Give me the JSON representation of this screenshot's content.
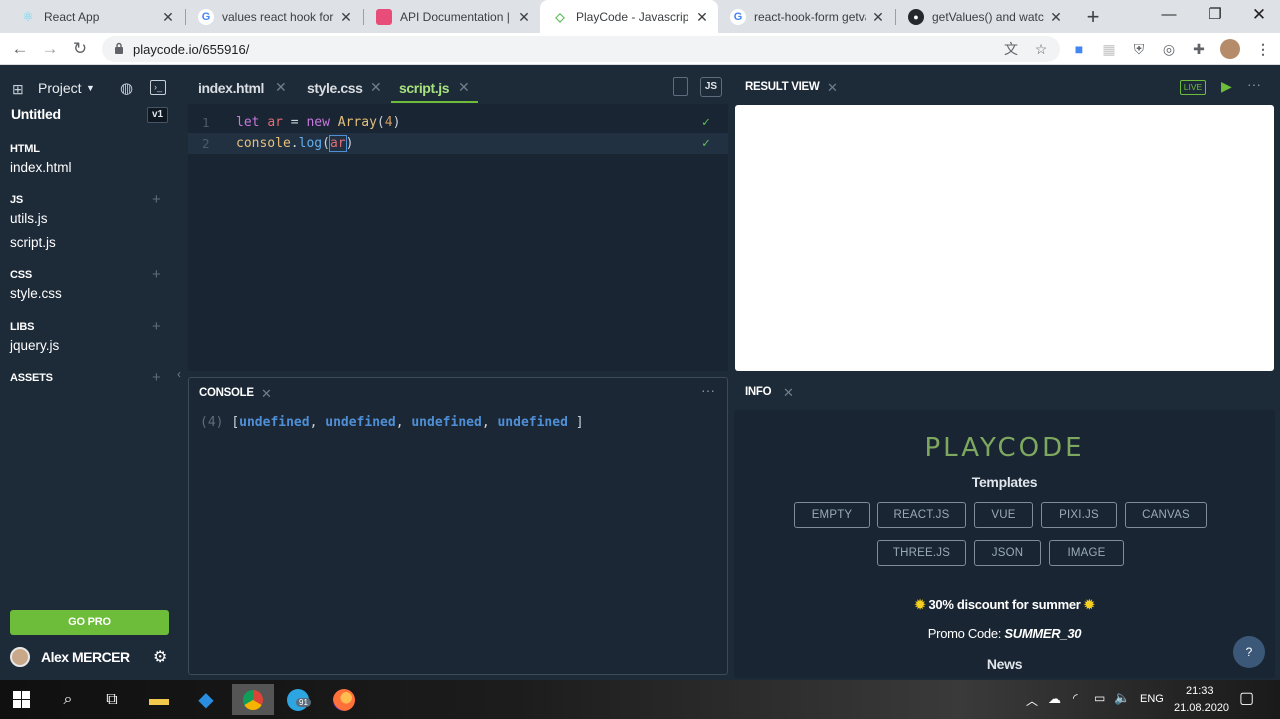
{
  "browser": {
    "tabs": [
      {
        "title": "React App",
        "icon": "react-icon"
      },
      {
        "title": "values react hook form",
        "icon": "google-icon"
      },
      {
        "title": "API Documentation | Re",
        "icon": "doc-icon"
      },
      {
        "title": "PlayCode - Javascript P",
        "icon": "playcode-icon",
        "active": true
      },
      {
        "title": "react-hook-form getval",
        "icon": "google-icon"
      },
      {
        "title": "getValues() and watch()",
        "icon": "github-icon"
      }
    ],
    "url": "playcode.io/655916/"
  },
  "sidebar": {
    "project_label": "Project",
    "project_name": "Untitled",
    "version_badge": "v1",
    "sections": [
      {
        "title": "HTML",
        "files": [
          "index.html"
        ],
        "addable": false
      },
      {
        "title": "JS",
        "files": [
          "utils.js",
          "script.js"
        ],
        "addable": true
      },
      {
        "title": "CSS",
        "files": [
          "style.css"
        ],
        "addable": true
      },
      {
        "title": "LIBS",
        "files": [
          "jquery.js"
        ],
        "addable": true
      },
      {
        "title": "ASSETS",
        "files": [],
        "addable": true
      }
    ],
    "go_pro_label": "GO PRO",
    "user_name": "Alex MERCER"
  },
  "editor": {
    "tabs": [
      "index.html",
      "style.css",
      "script.js"
    ],
    "active_tab": "script.js",
    "lang_badge": "JS",
    "lines": [
      {
        "num": "1",
        "tokens": [
          [
            "let ",
            "#c678dd"
          ],
          [
            "ar",
            "#e06c75"
          ],
          [
            " = ",
            "#c9d1d9"
          ],
          [
            "new ",
            "#c678dd"
          ],
          [
            "Array",
            "#e5c07b"
          ],
          [
            "(",
            "#c9d1d9"
          ],
          [
            "4",
            "#d19a66"
          ],
          [
            ")",
            "#c9d1d9"
          ]
        ]
      },
      {
        "num": "2",
        "tokens": [
          [
            "console",
            "#e5c07b"
          ],
          [
            ".",
            "#c9d1d9"
          ],
          [
            "log",
            "#61afef"
          ],
          [
            "(",
            "#c9d1d9"
          ],
          [
            "ar",
            "#e06c75"
          ],
          [
            ")",
            "#c9d1d9"
          ]
        ]
      }
    ]
  },
  "result": {
    "title": "RESULT VIEW",
    "live_badge": "LIVE"
  },
  "console": {
    "title": "CONSOLE",
    "output_count": "(4)",
    "output_items": [
      "undefined",
      "undefined",
      "undefined",
      "undefined"
    ]
  },
  "info": {
    "title": "INFO",
    "brand": "PLAYCODE",
    "templates_title": "Templates",
    "templates_row1": [
      "EMPTY",
      "REACT.JS",
      "VUE",
      "PIXI.JS",
      "CANVAS"
    ],
    "templates_row2": [
      "THREE.JS",
      "JSON",
      "IMAGE"
    ],
    "discount_text": "30% discount for summer",
    "promo_label": "Promo Code:",
    "promo_code": "SUMMER_30",
    "news_title": "News",
    "help_label": "?"
  },
  "taskbar": {
    "telegram_badge": "91",
    "language": "ENG",
    "time": "21:33",
    "date": "21.08.2020"
  },
  "colors": {
    "accent_green": "#6dbd3a",
    "brand_text": "#7ea860",
    "link_blue": "#4f8fd6"
  }
}
